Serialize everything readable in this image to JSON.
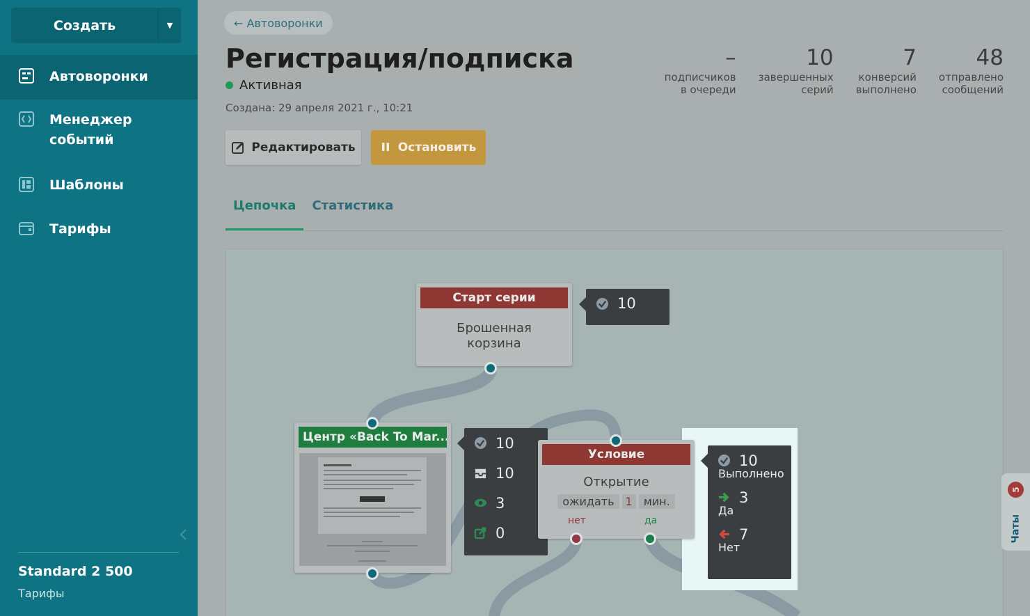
{
  "sidebar": {
    "create_label": "Создать",
    "items": [
      {
        "label": "Автоворонки",
        "icon": "funnel-icon"
      },
      {
        "label": "Менеджер событий",
        "icon": "events-icon"
      },
      {
        "label": "Шаблоны",
        "icon": "templates-icon"
      },
      {
        "label": "Тарифы",
        "icon": "wallet-icon"
      }
    ],
    "plan_name": "Standard 2 500",
    "plan_link": "Тарифы"
  },
  "header": {
    "back_label": "← Автоворонки",
    "title": "Регистрация/подписка",
    "status": "Активная",
    "created": "Создана: 29 апреля 2021 г., 10:21",
    "edit_label": "Редактировать",
    "stop_label": "Остановить"
  },
  "stats": [
    {
      "value": "–",
      "label": "подписчиков\nв очереди"
    },
    {
      "value": "10",
      "label": "завершенных\nсерий"
    },
    {
      "value": "7",
      "label": "конверсий\nвыполнено"
    },
    {
      "value": "48",
      "label": "отправлено\nсообщений"
    }
  ],
  "tabs": [
    {
      "label": "Цепочка",
      "active": true
    },
    {
      "label": "Статистика",
      "active": false
    }
  ],
  "flow": {
    "start": {
      "header": "Старт серии",
      "body": "Брошенная корзина",
      "done": "10"
    },
    "email": {
      "header": "Центр «Back To Mar...",
      "done": "10",
      "delivered": "10",
      "opened": "3",
      "clicked": "0"
    },
    "condition": {
      "header": "Условие",
      "body": "Открытие",
      "wait_label": "ожидать",
      "wait_value": "1",
      "wait_unit": "мин.",
      "no_label": "нет",
      "yes_label": "да",
      "done": "10",
      "done_label": "Выполнено",
      "yes_count": "3",
      "yes_text": "Да",
      "no_count": "7",
      "no_text": "Нет"
    }
  },
  "chats": {
    "label": "Чаты",
    "badge": "5"
  },
  "colors": {
    "sidebar": "#0e7383",
    "start_header": "#8f3732",
    "email_header": "#1f7d3f",
    "stop_button": "#c3973e",
    "active_tab": "#1f9a68"
  }
}
